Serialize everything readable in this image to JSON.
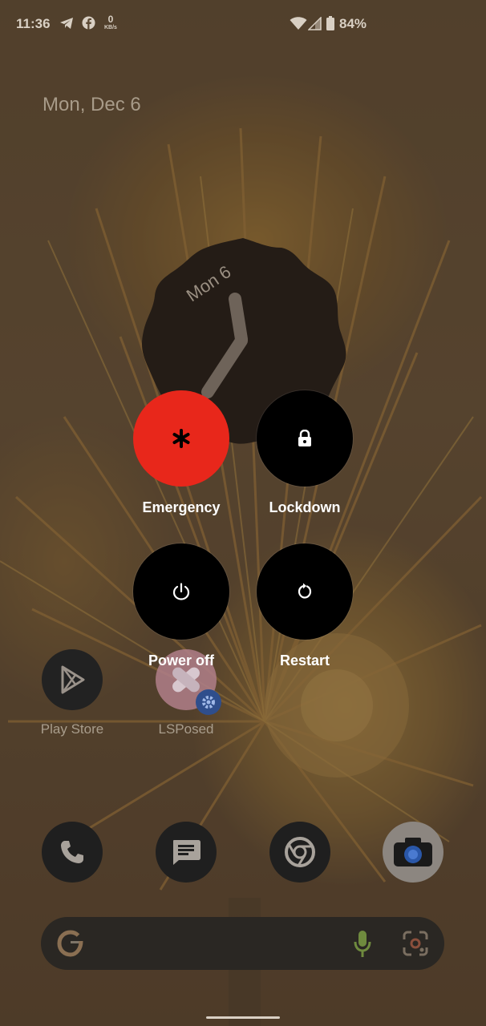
{
  "status_bar": {
    "time": "11:36",
    "net_speed_value": "0",
    "net_speed_unit": "KB/s",
    "battery": "84%",
    "icons": [
      "telegram-icon",
      "facebook-icon",
      "wifi-icon",
      "signal-icon",
      "battery-icon"
    ]
  },
  "home": {
    "date": "Mon, Dec 6",
    "clock_date": "Mon 6"
  },
  "power_menu": {
    "emergency_label": "Emergency",
    "lockdown_label": "Lockdown",
    "power_off_label": "Power off",
    "restart_label": "Restart",
    "emergency_color": "#e8271b"
  },
  "apps": {
    "play_store": "Play Store",
    "lsposed": "LSPosed"
  },
  "dock": [
    "phone-icon",
    "messages-icon",
    "chrome-icon",
    "camera-icon"
  ],
  "search": {
    "icons": [
      "google-icon",
      "mic-icon",
      "lens-icon"
    ]
  }
}
